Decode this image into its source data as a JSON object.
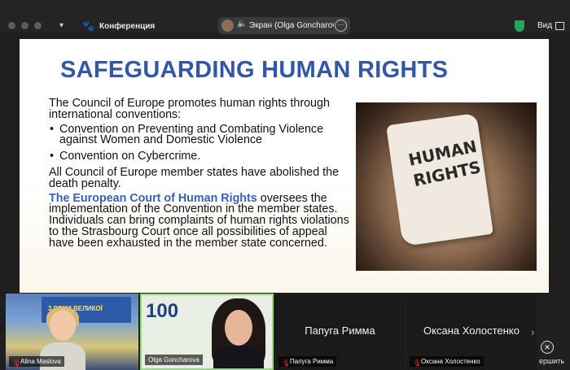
{
  "topbar": {
    "meeting_title": "Конференция",
    "share_label": "Экран (Olga Goncharova",
    "view_label": "Вид",
    "more_glyph": "···"
  },
  "slide": {
    "title": "SAFEGUARDING HUMAN RIGHTS",
    "intro": "The Council of Europe promotes human rights through international conventions:",
    "bullets": [
      "Convention on Preventing and Combating Violence against Women and Domestic Violence",
      "Convention on Cybercrime."
    ],
    "death_penalty": "All Council of Europe member states have abolished the death penalty.",
    "court_name": "The European Court of Human Rights",
    "court_text": " oversees the implementation of the Convention in the member states. Individuals can bring complaints of human rights violations to the Strasbourg Court once all possibilities of appeal have been exhausted in the member state concerned.",
    "image_text": "HUMAN RIGHTS"
  },
  "participants": [
    {
      "name": "Alina Maslova",
      "banner": "3 РОКИ ВЕЛИКОЇ",
      "muted": true
    },
    {
      "name": "Olga Goncharova",
      "logo": "100",
      "muted": false
    },
    {
      "name": "Папуга  Римма",
      "muted": true
    },
    {
      "name": "Оксана Холостенко",
      "muted": true
    }
  ],
  "controls": {
    "next_glyph": "›",
    "end_label": "ершить",
    "end_glyph": "✕"
  }
}
